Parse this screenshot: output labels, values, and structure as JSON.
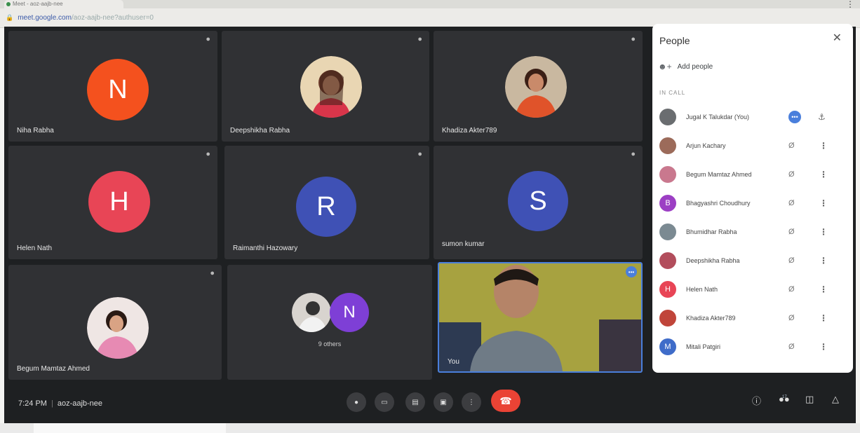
{
  "browser": {
    "tab_title": "Meet - aoz-aajb-nee",
    "url_host": "meet.google.com",
    "url_path": "/aoz-aajb-nee?authuser=0"
  },
  "tiles": [
    {
      "name": "Niha Rabha",
      "initial": "N",
      "color": "#f4511e"
    },
    {
      "name": "Deepshikha Rabha",
      "initial": "",
      "color": "#b24d5c"
    },
    {
      "name": "Khadiza Akter789",
      "initial": "",
      "color": "#c0453a"
    },
    {
      "name": "Helen Nath",
      "initial": "H",
      "color": "#e84556"
    },
    {
      "name": "Raimanthi Hazowary",
      "initial": "R",
      "color": "#3f51b5"
    },
    {
      "name": "sumon kumar",
      "initial": "S",
      "color": "#3f51b5"
    },
    {
      "name": "Begum Mamtaz Ahmed",
      "initial": "",
      "color": "#c9788e"
    },
    {
      "name": "9 others",
      "initial": "N",
      "color": "#7e3fd6"
    },
    {
      "name": "You",
      "initial": "",
      "color": "#c8c04a"
    }
  ],
  "people_panel": {
    "title": "People",
    "add_people": "Add people",
    "section": "IN CALL",
    "people": [
      {
        "name": "Jugal K Talukdar (You)",
        "initial": "",
        "color": "#6a6d70"
      },
      {
        "name": "Arjun Kachary",
        "initial": "",
        "color": "#9c6b5a"
      },
      {
        "name": "Begum Mamtaz Ahmed",
        "initial": "",
        "color": "#c9788e"
      },
      {
        "name": "Bhagyashri Choudhury",
        "initial": "B",
        "color": "#9c3fc4"
      },
      {
        "name": "Bhumidhar Rabha",
        "initial": "",
        "color": "#7b8a92"
      },
      {
        "name": "Deepshikha Rabha",
        "initial": "",
        "color": "#b24d5c"
      },
      {
        "name": "Helen Nath",
        "initial": "H",
        "color": "#e84556"
      },
      {
        "name": "Khadiza Akter789",
        "initial": "",
        "color": "#c0453a"
      },
      {
        "name": "Mitali Patgiri",
        "initial": "M",
        "color": "#3f6cc9"
      }
    ]
  },
  "bottom": {
    "time": "7:24 PM",
    "meeting_code": "aoz-aajb-nee",
    "people_count": "17"
  }
}
